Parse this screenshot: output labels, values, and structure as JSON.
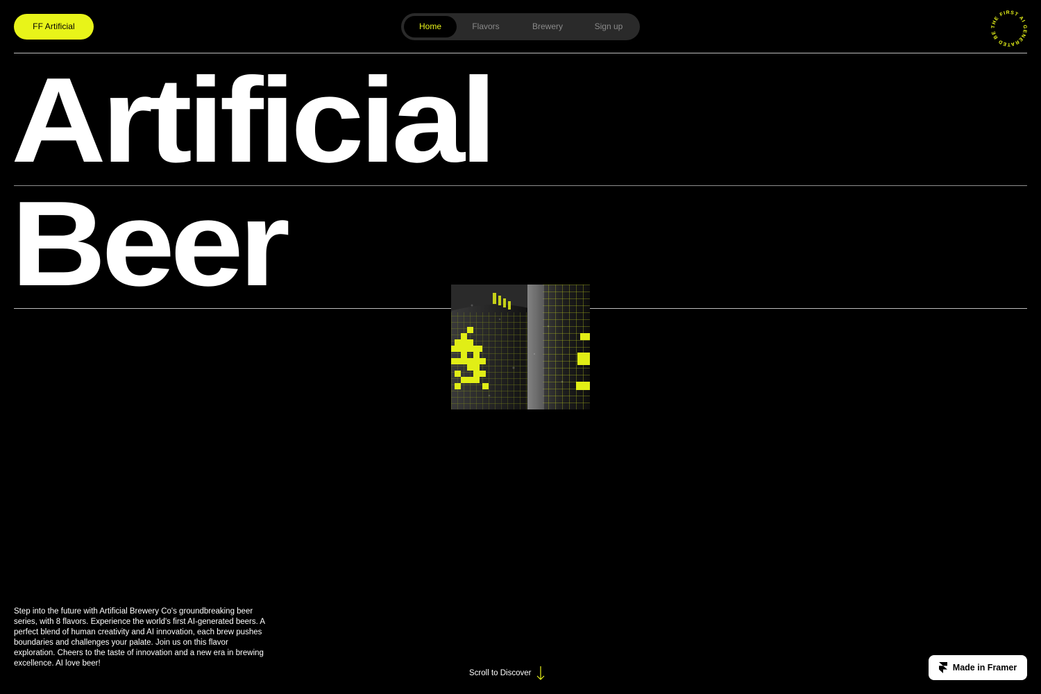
{
  "header": {
    "brand_label": "FF Artificial",
    "badge_text": "THE FIRST AI GENERATED BEER • "
  },
  "nav": {
    "items": [
      {
        "label": "Home",
        "active": true
      },
      {
        "label": "Flavors",
        "active": false
      },
      {
        "label": "Brewery",
        "active": false
      },
      {
        "label": "Sign up",
        "active": false
      }
    ]
  },
  "hero": {
    "line1": "Artificial",
    "line2": "Beer"
  },
  "intro": {
    "text": "Step into the future with Artificial Brewery Co's groundbreaking beer series, with 8 flavors. Experience the world's first AI-generated beers. A perfect blend of human creativity and AI innovation, each brew pushes boundaries and challenges your palate. Join us on this flavor exploration. Cheers to the taste of innovation and a new era in brewing excellence. AI love beer!"
  },
  "scroll": {
    "label": "Scroll to Discover"
  },
  "badge_framer": {
    "label": "Made in Framer"
  },
  "colors": {
    "accent": "#e8f419",
    "background": "#000000",
    "nav_bg": "#2a2a2a",
    "muted": "#8a8a8a"
  },
  "icons": {
    "scroll": "arrow-down-icon",
    "framer": "framer-logo-icon",
    "badge": "rotating-text-badge"
  }
}
